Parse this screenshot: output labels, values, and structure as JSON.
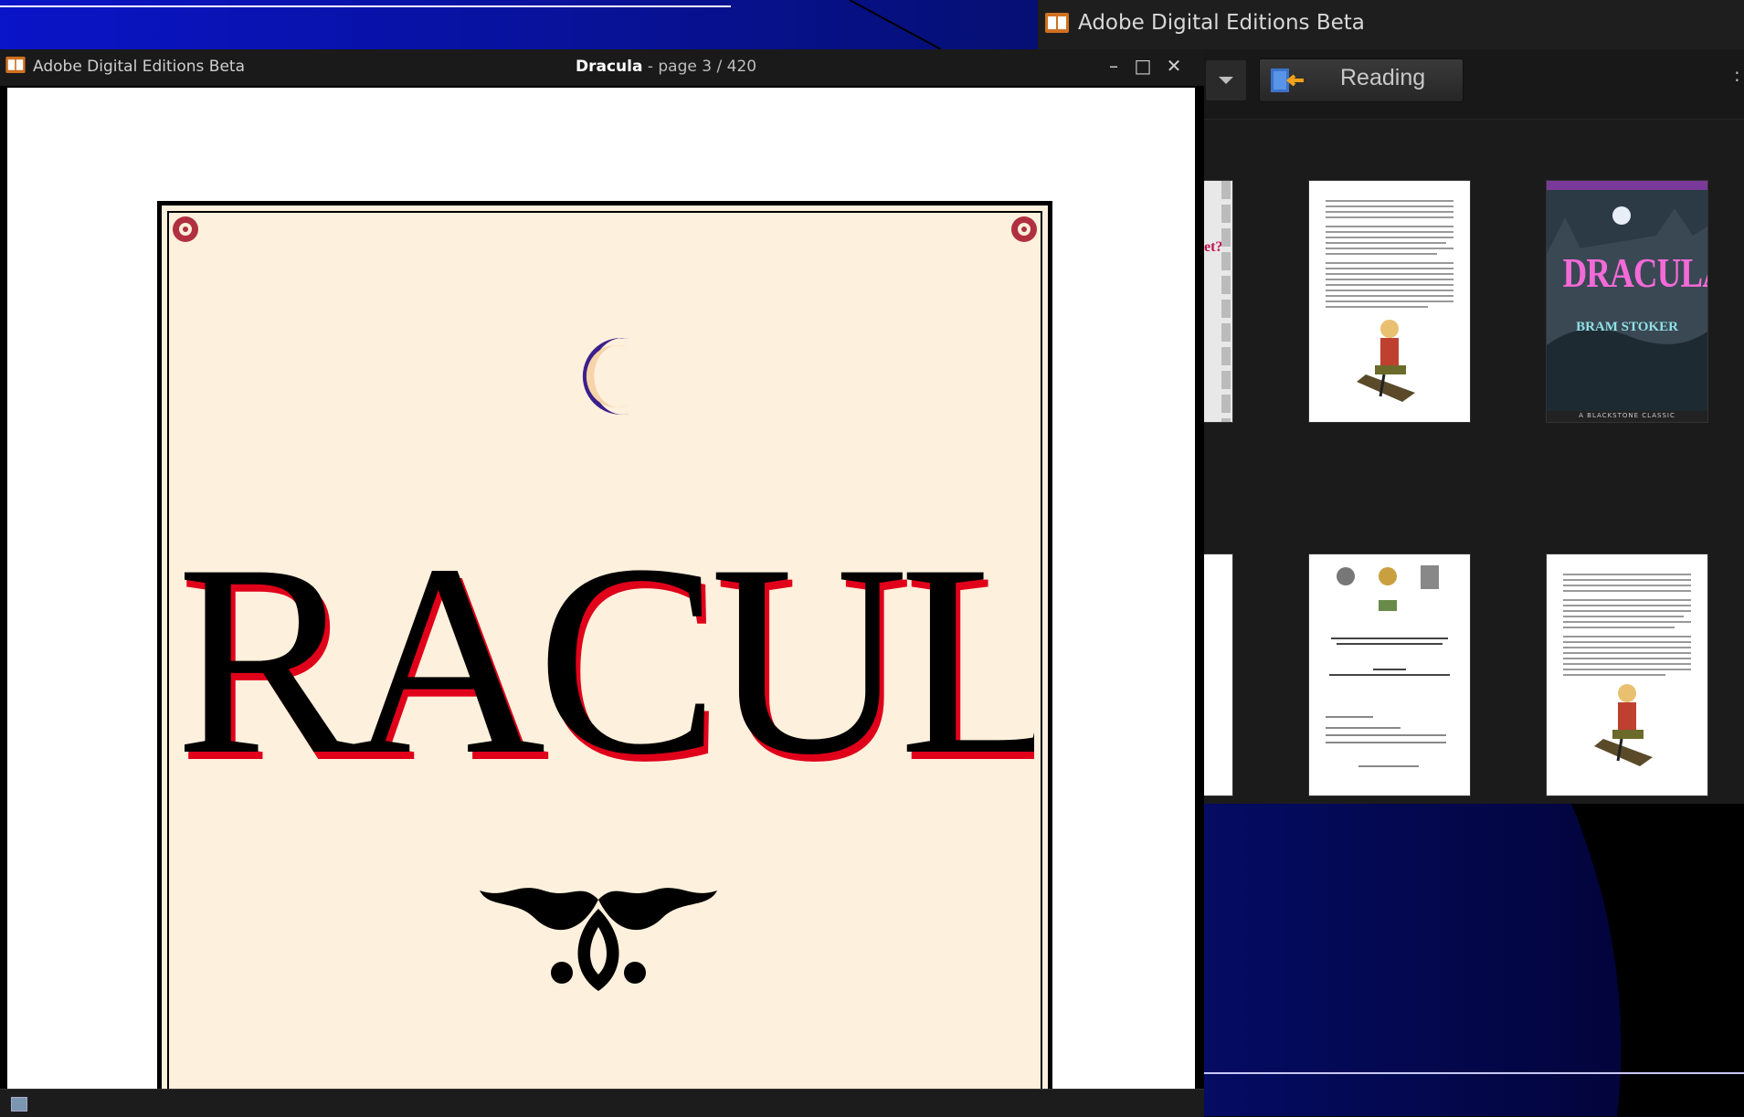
{
  "background_window": {
    "title": "Adobe Digital Editions Beta",
    "reading_button_label": "Reading",
    "more_label": ":",
    "book_covers": [
      {
        "title": "DRACULA",
        "author": "BRAM STOKER",
        "subtitle": "A BLACKSTONE CLASSIC"
      }
    ],
    "partial_cover_text": "et?"
  },
  "reader_window": {
    "app_title": "Adobe Digital Editions Beta",
    "doc_title": "Dracula",
    "page_prefix": " - page ",
    "page_current": "3",
    "page_separator": " / ",
    "page_total": "420",
    "controls": {
      "minimize": "–",
      "maximize": "□",
      "close": "✕"
    }
  },
  "book_page": {
    "title": "DRACULA",
    "title_colors": {
      "main": "#000000",
      "shadow": "#e0001a"
    },
    "moon_color": "#3b1f8c"
  },
  "colors": {
    "slide_gradient_start": "#0a1ad8",
    "slide_gradient_end": "#02022a",
    "page_background": "#fdf0dc"
  }
}
